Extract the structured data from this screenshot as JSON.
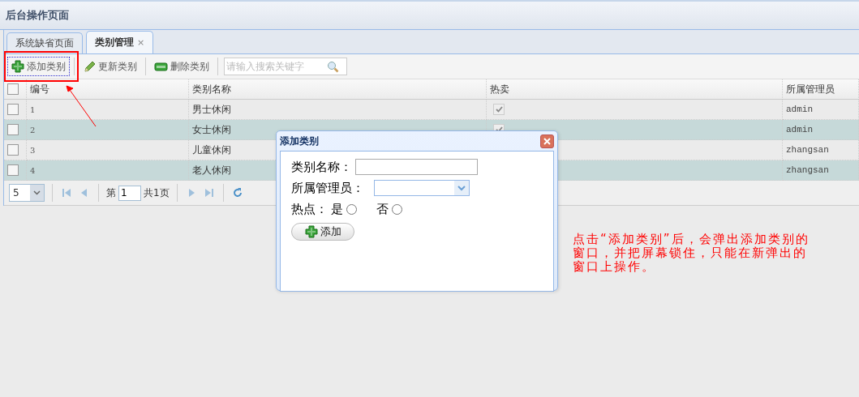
{
  "header": {
    "title": "后台操作页面"
  },
  "tabs": [
    {
      "label": "系统缺省页面",
      "selected": false
    },
    {
      "label": "类别管理",
      "selected": true,
      "close": "×"
    }
  ],
  "toolbar": {
    "buttons": [
      {
        "label": "添加类别",
        "kind": "add",
        "focused": true
      },
      {
        "label": "更新类别",
        "kind": "edit",
        "focused": false
      },
      {
        "label": "删除类别",
        "kind": "remove",
        "focused": false
      }
    ],
    "search": {
      "placeholder": "请输入搜索关键字"
    }
  },
  "table": {
    "all_checked": false,
    "columns": [
      "编号",
      "类别名称",
      "热卖",
      "所属管理员"
    ],
    "rows": [
      {
        "checked": false,
        "id": "1",
        "name": "男士休闲",
        "hot": true,
        "admin": "admin"
      },
      {
        "checked": false,
        "id": "2",
        "name": "女士休闲",
        "hot": true,
        "admin": "admin"
      },
      {
        "checked": false,
        "id": "3",
        "name": "儿童休闲",
        "admin": "zhangsan"
      },
      {
        "checked": false,
        "id": "4",
        "name": "老人休闲",
        "admin": "zhangsan"
      }
    ]
  },
  "pager": {
    "page_size": "5",
    "page_prefix": "第",
    "page": "1",
    "total": "共1页"
  },
  "dialog": {
    "title": "添加类别",
    "fields": [
      {
        "kind": "text",
        "label": "类别名称："
      },
      {
        "kind": "select",
        "label": "所属管理员："
      },
      {
        "kind": "radio",
        "label": "热点：",
        "options": [
          {
            "label": "是",
            "selected": false
          },
          {
            "label": "否",
            "selected": false
          }
        ]
      }
    ],
    "submit": "添加"
  },
  "annotation": "点击“添加类别”后，会弹出添加类别的窗口，并把屏幕锁住，只能在新弹出的窗口上操作。"
}
